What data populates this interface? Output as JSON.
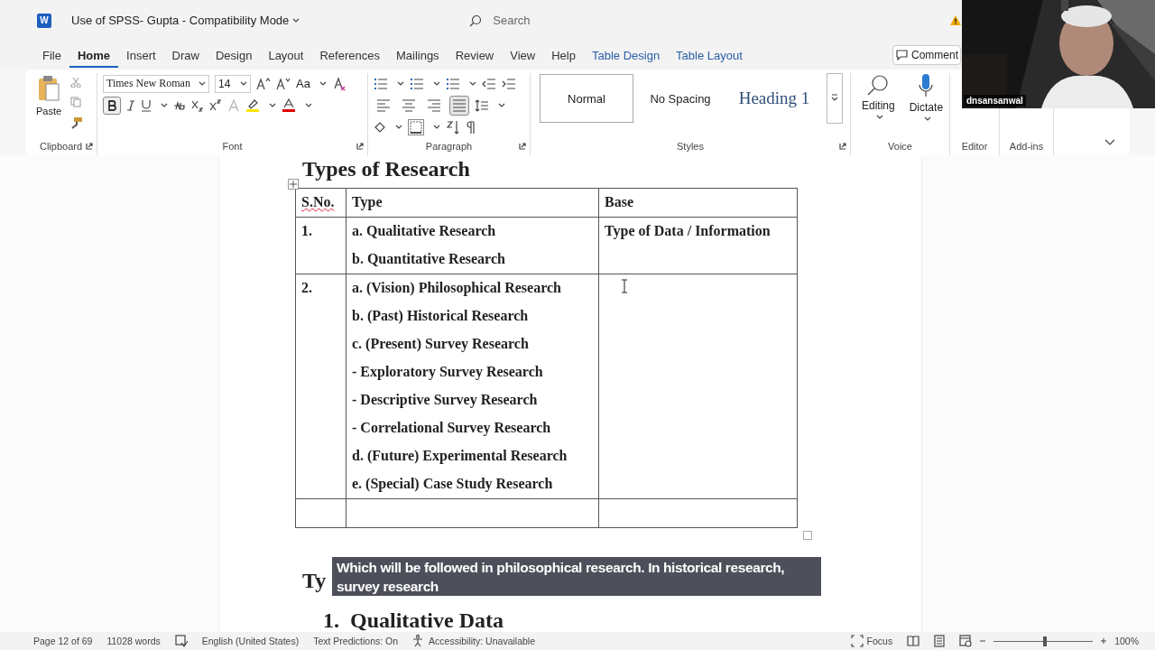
{
  "title_bar": {
    "app_badge": "W",
    "document_title": "Use of SPSS- Gupta  -  Compatibility Mode",
    "search_placeholder": "Search"
  },
  "tabs": [
    {
      "label": "File",
      "selected": false,
      "kind": "normal"
    },
    {
      "label": "Home",
      "selected": true,
      "kind": "normal"
    },
    {
      "label": "Insert",
      "selected": false,
      "kind": "normal"
    },
    {
      "label": "Draw",
      "selected": false,
      "kind": "normal"
    },
    {
      "label": "Design",
      "selected": false,
      "kind": "normal"
    },
    {
      "label": "Layout",
      "selected": false,
      "kind": "normal"
    },
    {
      "label": "References",
      "selected": false,
      "kind": "normal"
    },
    {
      "label": "Mailings",
      "selected": false,
      "kind": "normal"
    },
    {
      "label": "Review",
      "selected": false,
      "kind": "normal"
    },
    {
      "label": "View",
      "selected": false,
      "kind": "normal"
    },
    {
      "label": "Help",
      "selected": false,
      "kind": "normal"
    },
    {
      "label": "Table Design",
      "selected": false,
      "kind": "contextual"
    },
    {
      "label": "Table Layout",
      "selected": false,
      "kind": "contextual"
    }
  ],
  "comment_button": "Comment",
  "ribbon": {
    "clipboard": {
      "label": "Clipboard",
      "paste": "Paste"
    },
    "font": {
      "label": "Font",
      "font_name": "Times New Roman",
      "font_size": "14",
      "case_button": "Aa",
      "bold_on": true
    },
    "paragraph": {
      "label": "Paragraph",
      "alignments": [
        {
          "selected": false
        },
        {
          "selected": false
        },
        {
          "selected": false
        },
        {
          "selected": true
        }
      ]
    },
    "styles": {
      "label": "Styles",
      "items": [
        {
          "label": "Normal",
          "selected": true,
          "kind": "normal"
        },
        {
          "label": "No Spacing",
          "selected": false,
          "kind": "plain"
        },
        {
          "label": "Heading 1",
          "selected": false,
          "kind": "heading"
        }
      ]
    },
    "editing": "Editing",
    "dictate": "Dictate",
    "group_labels": [
      "Voice",
      "Editor",
      "Add-ins"
    ]
  },
  "document": {
    "heading": "Types of Research",
    "table": {
      "columns": [
        "S.No.",
        "Type",
        "Base"
      ],
      "rows": [
        {
          "number": "1.",
          "types": [
            "a. Qualitative Research",
            "b. Quantitative Research"
          ],
          "base": "Type of Data / Information"
        },
        {
          "number": "2.",
          "types": [
            "a. (Vision) Philosophical Research",
            "b. (Past) Historical Research",
            "c. (Present) Survey Research",
            "- Exploratory Survey Research",
            "- Descriptive Survey Research",
            "- Correlational Survey Research",
            "d. (Future) Experimental Research",
            "e. (Special) Case Study Research"
          ]
        },
        {}
      ]
    },
    "partial_heading": "Ty",
    "next_heading": {
      "number": "1.",
      "text": "Qualitative Data"
    }
  },
  "caption": "Which will be followed in philosophical research. In historical research, survey research",
  "webcam": {
    "name_tag": "dnsansanwal"
  },
  "status_bar": {
    "page": "Page 12 of 69",
    "words": "11028 words",
    "language": "English (United States)",
    "text_predictions": "Text Predictions: On",
    "accessibility": "Accessibility: Unavailable",
    "focus": "Focus",
    "zoom_slider": {
      "level": 0.52
    },
    "zoom": "100%"
  }
}
